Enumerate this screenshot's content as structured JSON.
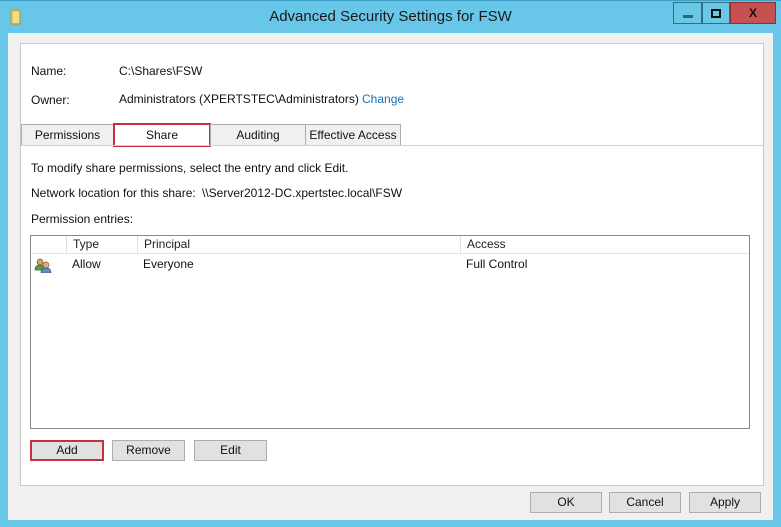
{
  "window": {
    "title": "Advanced Security Settings for FSW",
    "controls": {
      "minimize": "minimize",
      "maximize": "maximize",
      "close": "X"
    }
  },
  "info": {
    "name_label": "Name:",
    "name_value": "C:\\Shares\\FSW",
    "owner_label": "Owner:",
    "owner_value": "Administrators (XPERTSTEC\\Administrators)",
    "owner_change_link": "Change"
  },
  "tabs": [
    {
      "label": "Permissions",
      "active": false
    },
    {
      "label": "Share",
      "active": true
    },
    {
      "label": "Auditing",
      "active": false
    },
    {
      "label": "Effective Access",
      "active": false
    }
  ],
  "share": {
    "instruction": "To modify share permissions, select the entry and click Edit.",
    "network_location_label": "Network location for this share:",
    "network_location_value": "\\\\Server2012-DC.xpertstec.local\\FSW",
    "entries_label": "Permission entries:",
    "columns": [
      "",
      "Type",
      "Principal",
      "Access"
    ],
    "entries": [
      {
        "icon": "users-icon",
        "type": "Allow",
        "principal": "Everyone",
        "access": "Full Control"
      }
    ],
    "buttons": {
      "add": "Add",
      "remove": "Remove",
      "edit": "Edit"
    }
  },
  "footer": {
    "ok": "OK",
    "cancel": "Cancel",
    "apply": "Apply"
  },
  "colors": {
    "highlight": "#c4313c",
    "title_bar": "#68c6e8",
    "close": "#c75050",
    "link": "#1a6fb3"
  }
}
